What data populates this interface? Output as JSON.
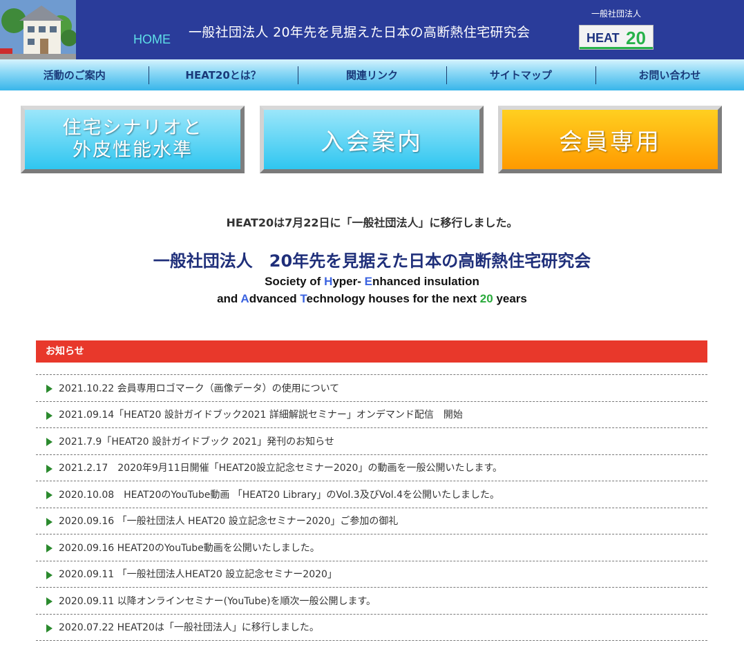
{
  "header": {
    "home": "HOME",
    "title": "一般社団法人 20年先を見据えた日本の高断熱住宅研究会",
    "badge_org": "一般社団法人",
    "badge_heat": "HEAT",
    "badge_num": "20"
  },
  "nav": [
    "活動のご案内",
    "HEAT20とは？",
    "関連リンク",
    "サイトマップ",
    "お問い合わせ"
  ],
  "buttons": {
    "scenario_line1": "住宅シナリオと",
    "scenario_line2": "外皮性能水準",
    "join": "入会案内",
    "member": "会員専用"
  },
  "announce": "HEAT20は7月22日に「一般社団法人」に移行しました。",
  "org_name": "一般社団法人　20年先を見据えた日本の高断熱住宅研究会",
  "english": {
    "l1_a": "Society of ",
    "l1_H": "H",
    "l1_b": "yper- ",
    "l1_E": "E",
    "l1_c": "nhanced insulation",
    "l2_a": "and ",
    "l2_A": "A",
    "l2_b": "dvanced ",
    "l2_T": "T",
    "l2_c": "echnology houses for the next ",
    "l2_20": "20",
    "l2_d": " years"
  },
  "news": {
    "title": "お知らせ",
    "items": [
      "2021.10.22 会員専用ロゴマーク（画像データ）の使用について",
      "2021.09.14「HEAT20 設計ガイドブック2021 詳細解説セミナー」オンデマンド配信　開始",
      "2021.7.9「HEAT20 設計ガイドブック 2021」発刊のお知らせ",
      "2021.2.17　2020年9月11日開催「HEAT20設立記念セミナー2020」の動画を一般公開いたします。",
      "2020.10.08　HEAT20のYouTube動画 「HEAT20 Library」のVol.3及びVol.4を公開いたしました。",
      "2020.09.16 「一般社団法人 HEAT20 設立記念セミナー2020」ご参加の御礼",
      "2020.09.16 HEAT20のYouTube動画を公開いたしました。",
      "2020.09.11 「一般社団法人HEAT20 設立記念セミナー2020」",
      "2020.09.11 以降オンラインセミナー(YouTube)を順次一般公開します。",
      "2020.07.22 HEAT20は「一般社団法人」に移行しました。"
    ]
  }
}
